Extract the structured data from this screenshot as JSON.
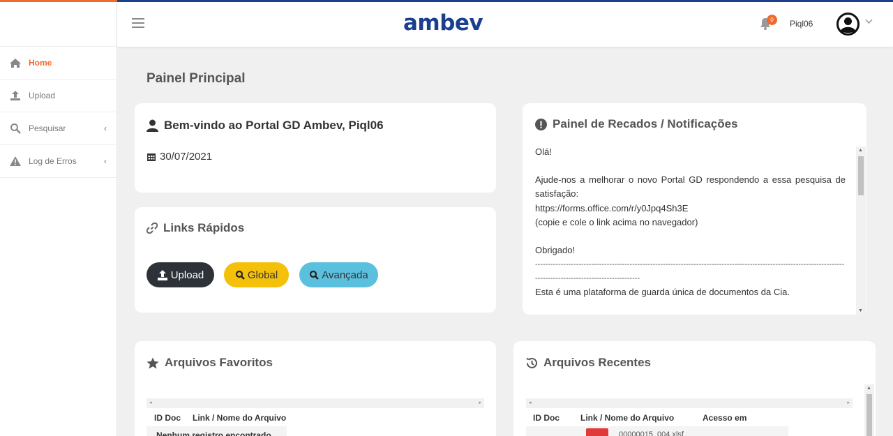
{
  "app": {
    "brand": "ambev"
  },
  "sidebar": {
    "items": [
      {
        "label": "Home",
        "icon": "home-icon",
        "active": true
      },
      {
        "label": "Upload",
        "icon": "upload-icon"
      },
      {
        "label": "Pesquisar",
        "icon": "search-icon",
        "chevron": "‹"
      },
      {
        "label": "Log de Erros",
        "icon": "warning-icon",
        "chevron": "‹"
      }
    ]
  },
  "header": {
    "notification_count": "0",
    "username": "Piql06"
  },
  "page": {
    "title": "Painel Principal"
  },
  "welcome": {
    "title": "Bem-vindo ao Portal GD Ambev, Piql06",
    "date": "30/07/2021"
  },
  "quick_links": {
    "title": "Links Rápidos",
    "buttons": [
      {
        "label": "Upload",
        "color": "#2d3238"
      },
      {
        "label": "Global",
        "color": "#f5c009"
      },
      {
        "label": "Avançada",
        "color": "#5bc0de"
      }
    ]
  },
  "notifications": {
    "title": "Painel de Recados / Notificações",
    "lines": [
      "Olá!",
      "",
      "Ajude-nos a melhorar o novo Portal GD respondendo a essa pesquisa de satisfação:",
      "https://forms.office.com/r/y0Jpq4Sh3E",
      "(copie e cole o link acima no navegador)",
      "",
      "Obrigado!",
      "------------------------------------------------------------------------------------------------------------------------------------------------------------------",
      "Esta é uma plataforma de guarda única de documentos da Cia."
    ]
  },
  "favorites": {
    "title": "Arquivos Favoritos",
    "columns": [
      "ID Doc",
      "Link / Nome do Arquivo"
    ],
    "empty_text": "Nenhum registro encontrado"
  },
  "recent": {
    "title": "Arquivos Recentes",
    "columns": [
      "ID Doc",
      "Link / Nome do Arquivo",
      "Acesso em"
    ],
    "first_file": "00000015_004.xlsf"
  },
  "colors": {
    "accent": "#ee6a2e",
    "brand": "#1a3f8f"
  }
}
